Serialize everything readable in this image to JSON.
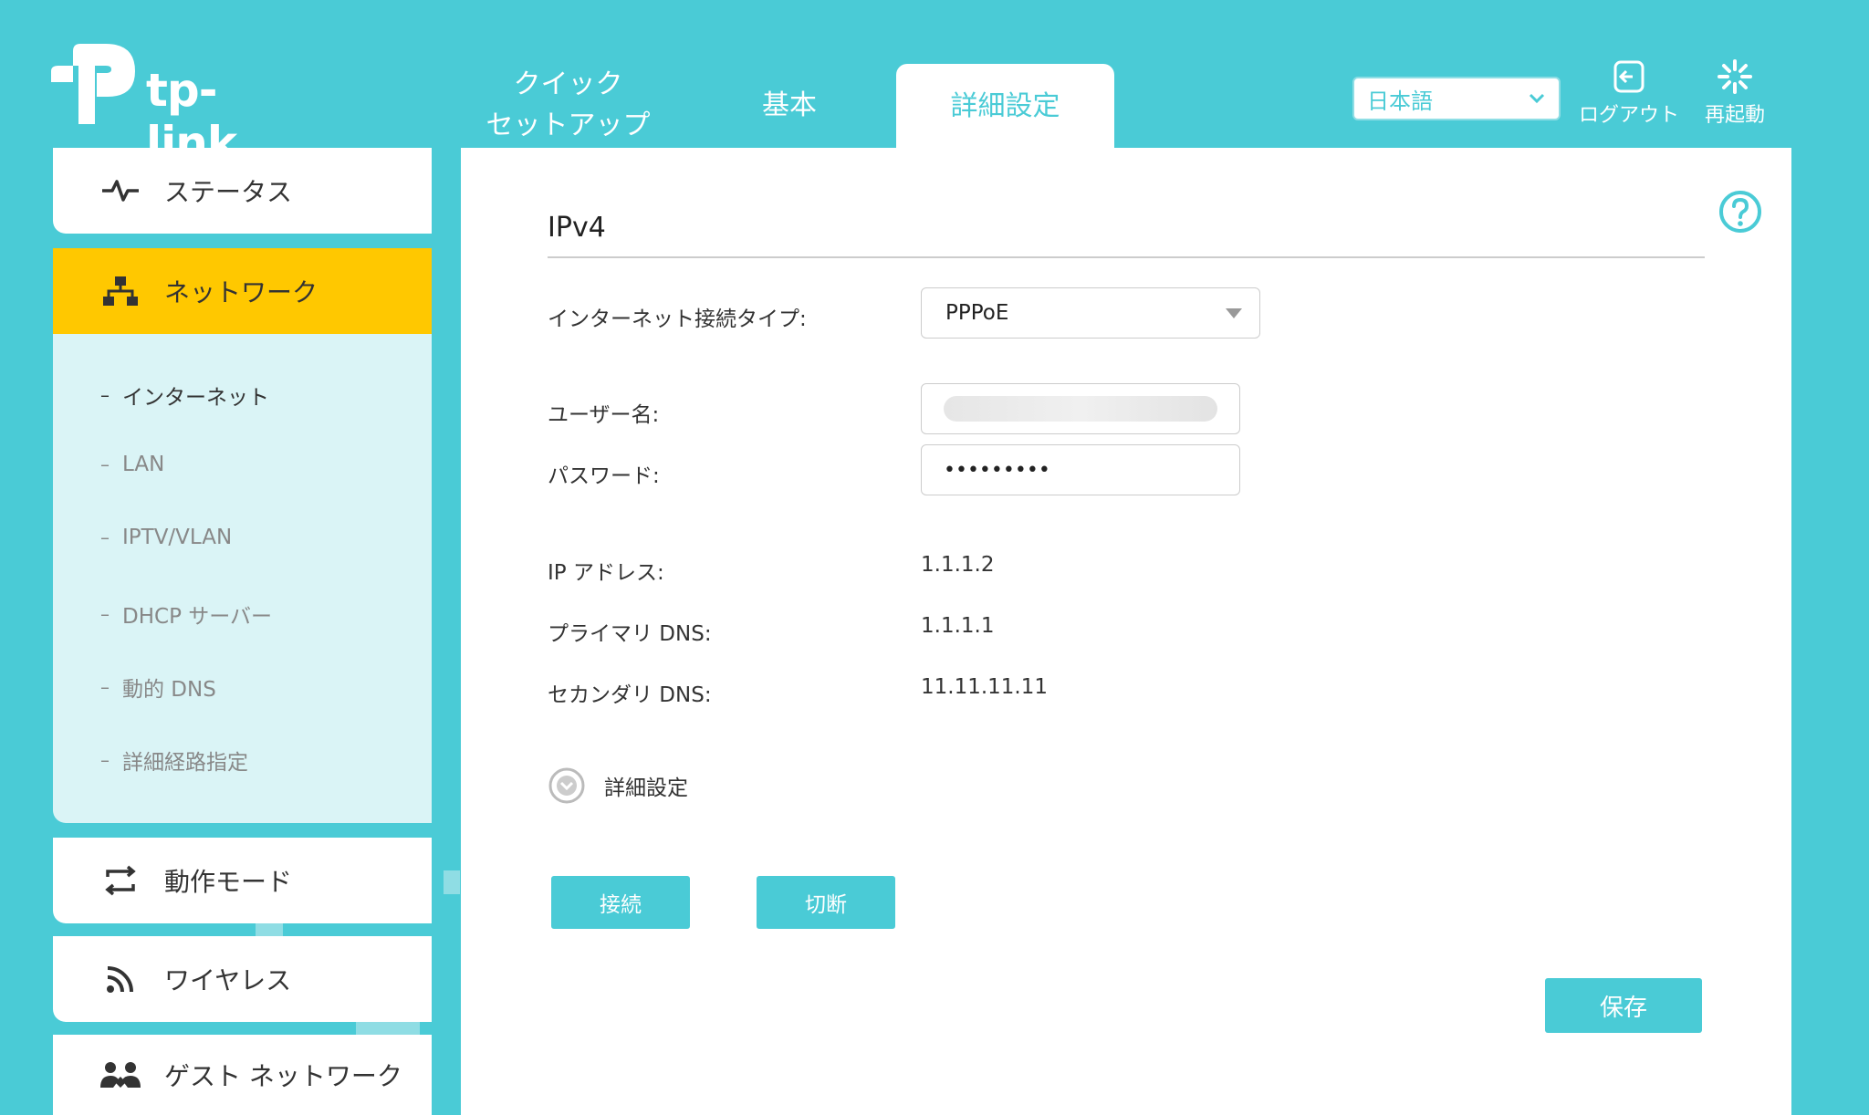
{
  "brand": {
    "name": "tp-link"
  },
  "nav": {
    "tabs": [
      {
        "line1": "クイック",
        "line2": "セットアップ"
      },
      {
        "label": "基本"
      },
      {
        "label": "詳細設定"
      }
    ],
    "language": "日本語",
    "logout_label": "ログアウト",
    "reboot_label": "再起動"
  },
  "sidebar": {
    "status": "ステータス",
    "network": "ネットワーク",
    "network_sub": [
      "インターネット",
      "LAN",
      "IPTV/VLAN",
      "DHCP サーバー",
      "動的 DNS",
      "詳細経路指定"
    ],
    "opmode": "動作モード",
    "wireless": "ワイヤレス",
    "guest": "ゲスト ネットワーク"
  },
  "main": {
    "section_title": "IPv4",
    "conn_type_label": "インターネット接続タイプ:",
    "conn_type_value": "PPPoE",
    "username_label": "ユーザー名:",
    "password_label": "パスワード:",
    "password_value": "•••••••••",
    "ip_label": "IP アドレス:",
    "ip_value": "1.1.1.2",
    "dns1_label": "プライマリ DNS:",
    "dns1_value": "1.1.1.1",
    "dns2_label": "セカンダリ DNS:",
    "dns2_value": "11.11.11.11",
    "advanced_label": "詳細設定",
    "connect_label": "接続",
    "disconnect_label": "切断",
    "save_label": "保存"
  },
  "colors": {
    "accent": "#4acbd6",
    "active_menu": "#ffc800",
    "submenu_bg": "#daf4f6"
  },
  "icons": {
    "status": "pulse-icon",
    "network": "network-tree-icon",
    "opmode": "loop-arrows-icon",
    "wireless": "wifi-rss-icon",
    "guest": "guest-users-icon",
    "logout": "logout-icon",
    "reboot": "reboot-spinner-icon",
    "help": "help-icon"
  }
}
